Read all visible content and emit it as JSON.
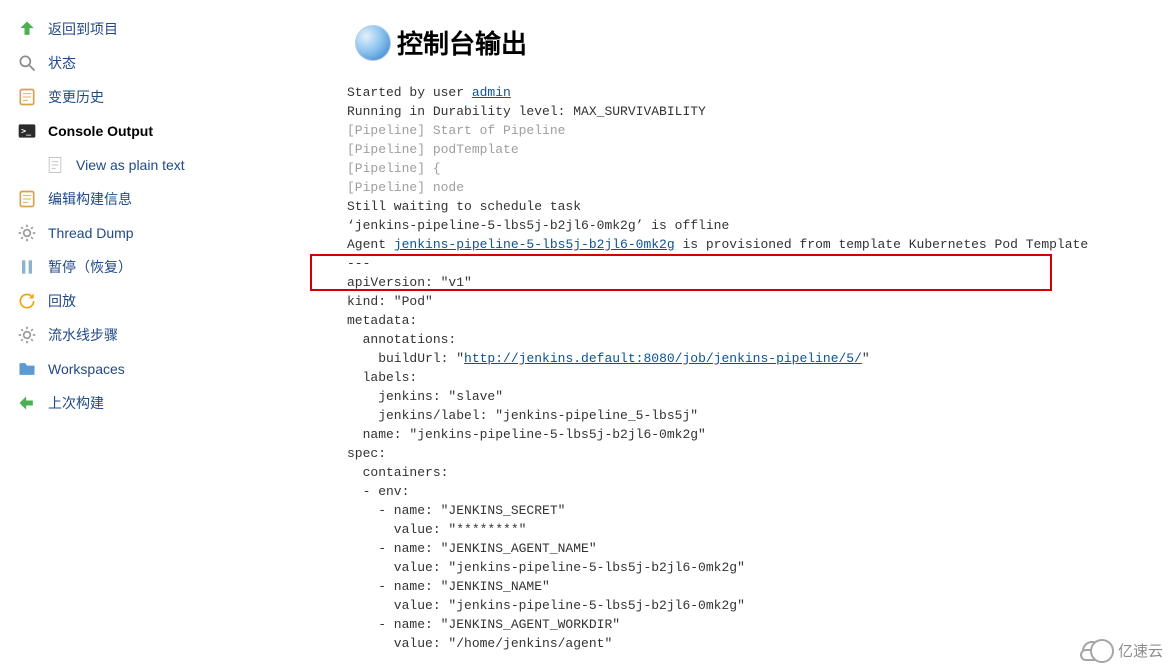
{
  "sidebar": {
    "items": [
      {
        "label": "返回到项目",
        "icon": "arrow-up",
        "color": "#4caf50"
      },
      {
        "label": "状态",
        "icon": "search",
        "color": "#888"
      },
      {
        "label": "变更历史",
        "icon": "notepad",
        "color": "#d8a24a"
      },
      {
        "label": "Console Output",
        "icon": "terminal",
        "color": "#333",
        "active": true
      },
      {
        "label": "View as plain text",
        "icon": "document",
        "color": "#bbb",
        "sub": true
      },
      {
        "label": "编辑构建信息",
        "icon": "notepad",
        "color": "#d8a24a"
      },
      {
        "label": "Thread Dump",
        "icon": "gear",
        "color": "#999"
      },
      {
        "label": "暂停（恢复）",
        "icon": "pause",
        "color": "#8db2c9"
      },
      {
        "label": "回放",
        "icon": "replay",
        "color": "#f0a30a"
      },
      {
        "label": "流水线步骤",
        "icon": "gear",
        "color": "#999"
      },
      {
        "label": "Workspaces",
        "icon": "folder",
        "color": "#5a9bd4"
      },
      {
        "label": "上次构建",
        "icon": "arrow-left",
        "color": "#4caf50"
      }
    ]
  },
  "main": {
    "title": "控制台输出",
    "console": {
      "l0_pre": "Started by user ",
      "l0_link": "admin",
      "l1": "Running in Durability level: MAX_SURVIVABILITY",
      "l2": "[Pipeline] Start of Pipeline",
      "l3": "[Pipeline] podTemplate",
      "l4": "[Pipeline] {",
      "l5": "[Pipeline] node",
      "l6": "Still waiting to schedule task",
      "l7": "‘jenkins-pipeline-5-lbs5j-b2jl6-0mk2g’ is offline",
      "l8_pre": "Agent ",
      "l8_link": "jenkins-pipeline-5-lbs5j-b2jl6-0mk2g",
      "l8_post": " is provisioned from template Kubernetes Pod Template",
      "l9": "---",
      "l10": "apiVersion: \"v1\"",
      "l11": "kind: \"Pod\"",
      "l12": "metadata:",
      "l13": "  annotations:",
      "l14_pre": "    buildUrl: \"",
      "l14_link": "http://jenkins.default:8080/job/jenkins-pipeline/5/",
      "l14_post": "\"",
      "l15": "  labels:",
      "l16": "    jenkins: \"slave\"",
      "l17": "    jenkins/label: \"jenkins-pipeline_5-lbs5j\"",
      "l18": "  name: \"jenkins-pipeline-5-lbs5j-b2jl6-0mk2g\"",
      "l19": "spec:",
      "l20": "  containers:",
      "l21": "  - env:",
      "l22": "    - name: \"JENKINS_SECRET\"",
      "l23": "      value: \"********\"",
      "l24": "    - name: \"JENKINS_AGENT_NAME\"",
      "l25": "      value: \"jenkins-pipeline-5-lbs5j-b2jl6-0mk2g\"",
      "l26": "    - name: \"JENKINS_NAME\"",
      "l27": "      value: \"jenkins-pipeline-5-lbs5j-b2jl6-0mk2g\"",
      "l28": "    - name: \"JENKINS_AGENT_WORKDIR\"",
      "l29": "      value: \"/home/jenkins/agent\""
    }
  },
  "watermark": {
    "text": "亿速云"
  }
}
